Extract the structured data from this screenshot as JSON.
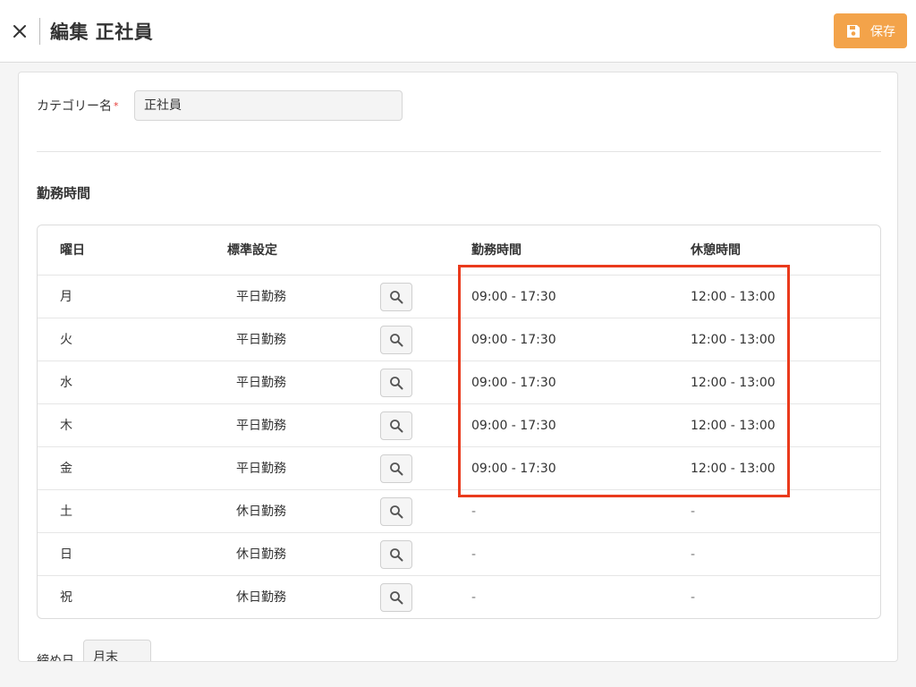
{
  "header": {
    "title": "編集 正社員",
    "save_label": "保存",
    "accent_color": "#f3a34a"
  },
  "form": {
    "category_label": "カテゴリー名",
    "required_mark": "*",
    "category_value": "正社員",
    "section_title": "勤務時間"
  },
  "table": {
    "headers": {
      "day": "曜日",
      "standard": "標準設定",
      "work_hours": "勤務時間",
      "break_hours": "休憩時間"
    },
    "rows": [
      {
        "day": "月",
        "standard": "平日勤務",
        "work": "09:00 - 17:30",
        "break": "12:00 - 13:00"
      },
      {
        "day": "火",
        "standard": "平日勤務",
        "work": "09:00 - 17:30",
        "break": "12:00 - 13:00"
      },
      {
        "day": "水",
        "standard": "平日勤務",
        "work": "09:00 - 17:30",
        "break": "12:00 - 13:00"
      },
      {
        "day": "木",
        "standard": "平日勤務",
        "work": "09:00 - 17:30",
        "break": "12:00 - 13:00"
      },
      {
        "day": "金",
        "standard": "平日勤務",
        "work": "09:00 - 17:30",
        "break": "12:00 - 13:00"
      },
      {
        "day": "土",
        "standard": "休日勤務",
        "work": "-",
        "break": "-"
      },
      {
        "day": "日",
        "standard": "休日勤務",
        "work": "-",
        "break": "-"
      },
      {
        "day": "祝",
        "standard": "休日勤務",
        "work": "-",
        "break": "-"
      }
    ]
  },
  "bottom": {
    "label": "締め日",
    "value": "月末"
  },
  "icons": {
    "close": "close-icon",
    "save": "save-icon",
    "lookup": "search-icon"
  }
}
